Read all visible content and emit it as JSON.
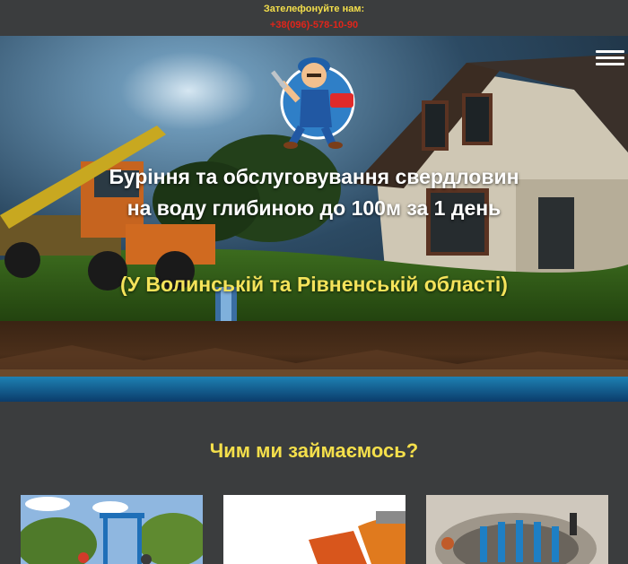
{
  "header": {
    "call_label": "Зателефонуйте нам:",
    "phone": "+38(096)-578-10-90",
    "menu_icon": "hamburger-menu-icon"
  },
  "hero": {
    "logo_icon": "plumber-mascot-logo",
    "title": "Буріння та обслуговування свердловин на воду глибиною до 100м за 1 день",
    "subtitle": "(У Волинській та Рівненській області)"
  },
  "services": {
    "title": "Чим ми займаємось?",
    "cards": [
      {
        "image": "drilling-rig-photo"
      },
      {
        "image": "hand-with-brick-photo"
      },
      {
        "image": "well-pipes-photo"
      }
    ]
  },
  "colors": {
    "background": "#3b3d3e",
    "accent_yellow": "#f4df4b",
    "phone_red": "#e1251b"
  }
}
